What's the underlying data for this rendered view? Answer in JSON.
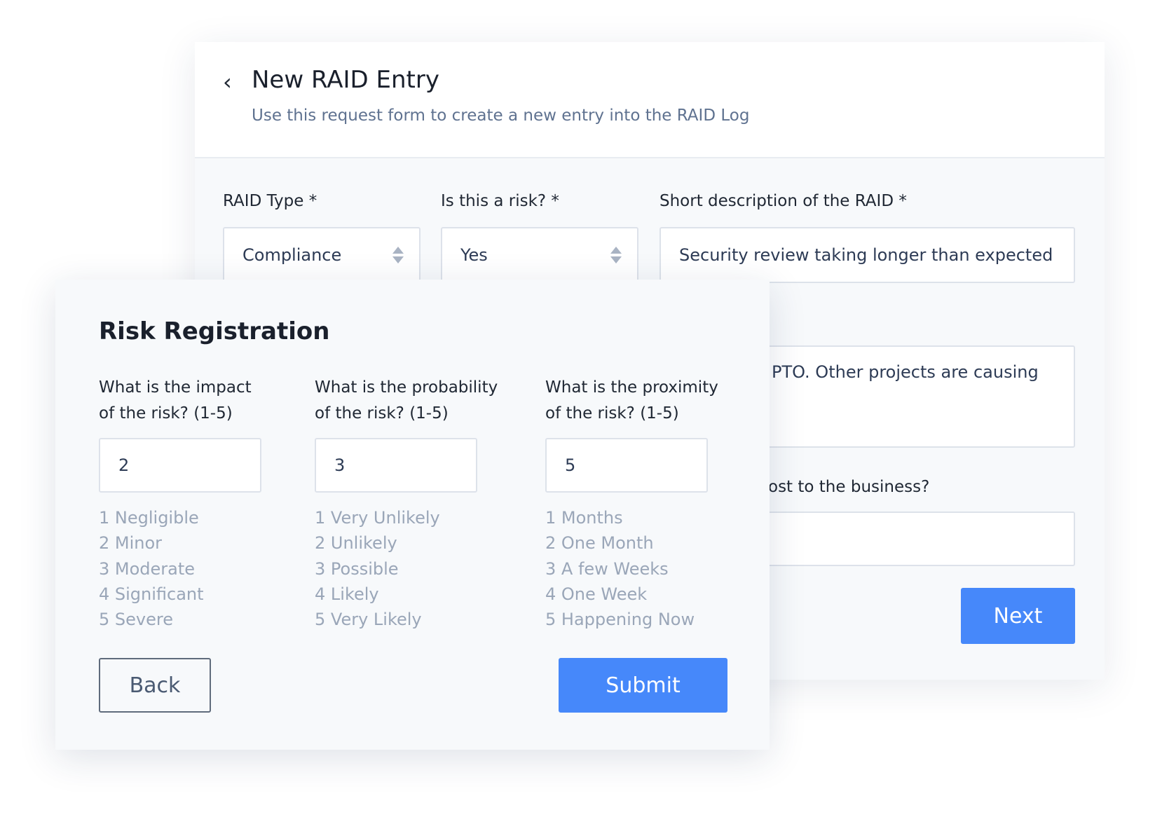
{
  "entry_form": {
    "title": "New RAID Entry",
    "subtitle": "Use this request form to create a new entry into the RAID Log",
    "fields": {
      "raid_type": {
        "label": "RAID Type *",
        "value": "Compliance"
      },
      "is_risk": {
        "label": "Is this a risk? *",
        "value": "Yes"
      },
      "short_description": {
        "label": "Short description of the RAID *",
        "value": "Security review taking longer than expected"
      },
      "long_description_visible": "PTO. Other projects are causing",
      "cost_label_visible": "ost to the business?",
      "cost_value": ""
    },
    "next_label": "Next"
  },
  "risk_registration": {
    "heading": "Risk Registration",
    "columns": [
      {
        "question_line1": "What is the impact",
        "question_line2": "of the risk? (1-5)",
        "value": "2",
        "options": [
          "1 Negligible",
          "2 Minor",
          "3 Moderate",
          "4 Significant",
          "5 Severe"
        ]
      },
      {
        "question_line1": "What is the probability",
        "question_line2": "of the risk? (1-5)",
        "value": "3",
        "options": [
          "1 Very Unlikely",
          "2 Unlikely",
          "3 Possible",
          "4 Likely",
          "5 Very Likely"
        ]
      },
      {
        "question_line1": "What is the proximity",
        "question_line2": "of the risk? (1-5)",
        "value": "5",
        "options": [
          "1 Months",
          "2 One Month",
          "3 A few Weeks",
          "4 One Week",
          "5 Happening Now"
        ]
      }
    ],
    "back_label": "Back",
    "submit_label": "Submit"
  },
  "colors": {
    "accent": "#4688fa",
    "muted_text": "#9aa6b8",
    "subtitle": "#5f7290"
  }
}
